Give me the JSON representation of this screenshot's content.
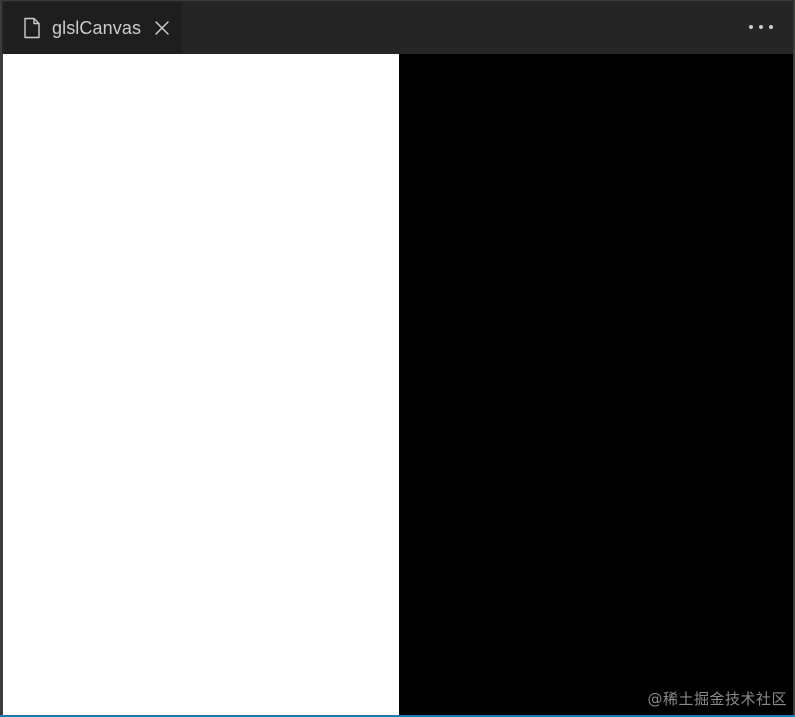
{
  "tab": {
    "title": "glslCanvas",
    "icon": "file-icon",
    "close_icon": "close-icon"
  },
  "toolbar": {
    "more_icon": "more-actions-icon"
  },
  "canvas": {
    "left_color": "#ffffff",
    "right_color": "#000000"
  },
  "watermark": {
    "text": "@稀土掘金技术社区"
  },
  "colors": {
    "tab_bar": "#252526",
    "active_tab": "#1e1e1e",
    "tab_text": "#cccccc",
    "status_accent": "#1e79b3"
  }
}
